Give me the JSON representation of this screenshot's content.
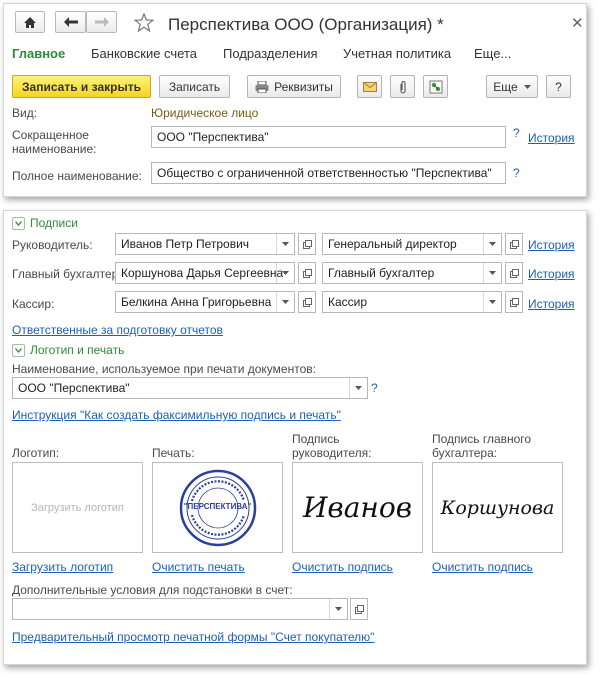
{
  "window": {
    "title": "Перспектива ООО (Организация) *"
  },
  "tabs": [
    {
      "label": "Главное"
    },
    {
      "label": "Банковские счета"
    },
    {
      "label": "Подразделения"
    },
    {
      "label": "Учетная политика"
    },
    {
      "label": "Еще..."
    }
  ],
  "toolbar": {
    "save_close": "Записать и закрыть",
    "save": "Записать",
    "details": "Реквизиты",
    "more": "Еще"
  },
  "main": {
    "kind_label": "Вид:",
    "kind_value": "Юридическое лицо",
    "short_name_label": "Сокращенное наименование:",
    "short_name_value": "ООО \"Перспектива\"",
    "full_name_label": "Полное наименование:",
    "full_name_value": "Общество с ограниченной ответственностью \"Перспектива\"",
    "help": "?",
    "history": "История"
  },
  "signatures": {
    "group_title": "Подписи",
    "rows": [
      {
        "role": "Руководитель:",
        "person": "Иванов Петр Петрович",
        "position": "Генеральный директор",
        "history": "История"
      },
      {
        "role": "Главный бухгалтер:",
        "person": "Коршунова Дарья Сергеевна",
        "position": "Главный бухгалтер",
        "history": "История"
      },
      {
        "role": "Кассир:",
        "person": "Белкина Анна  Григорьевна",
        "position": "Кассир",
        "history": "История"
      }
    ],
    "responsible_link": "Ответственные за подготовку отчетов"
  },
  "logo_print": {
    "group_title": "Логотип и печать",
    "print_name_label": "Наименование, используемое при печати документов:",
    "print_name_value": "ООО \"Перспектива\"",
    "instruction_link": "Инструкция \"Как создать факсимильную подпись и печать\"",
    "logo_label": "Логотип:",
    "stamp_label": "Печать:",
    "director_sig_label": "Подпись руководителя:",
    "accountant_sig_label": "Подпись главного бухгалтера:",
    "logo_placeholder": "Загрузить логотип",
    "stamp_text": "\"ПЕРСПЕКТИВА\"",
    "director_signature": "Иванов",
    "accountant_signature": "Коршунова",
    "load_logo_link": "Загрузить логотип",
    "clear_stamp_link": "Очистить печать",
    "clear_director_link": "Очистить подпись",
    "clear_accountant_link": "Очистить подпись",
    "extra_conditions_label": "Дополнительные условия для подстановки в счет:",
    "extra_conditions_value": "",
    "preview_link": "Предварительный просмотр печатной формы \"Счет покупателю\""
  },
  "colors": {
    "accent_green": "#2e8b3a",
    "link_blue": "#1f5fb5",
    "primary_button": "#f4d61f"
  }
}
